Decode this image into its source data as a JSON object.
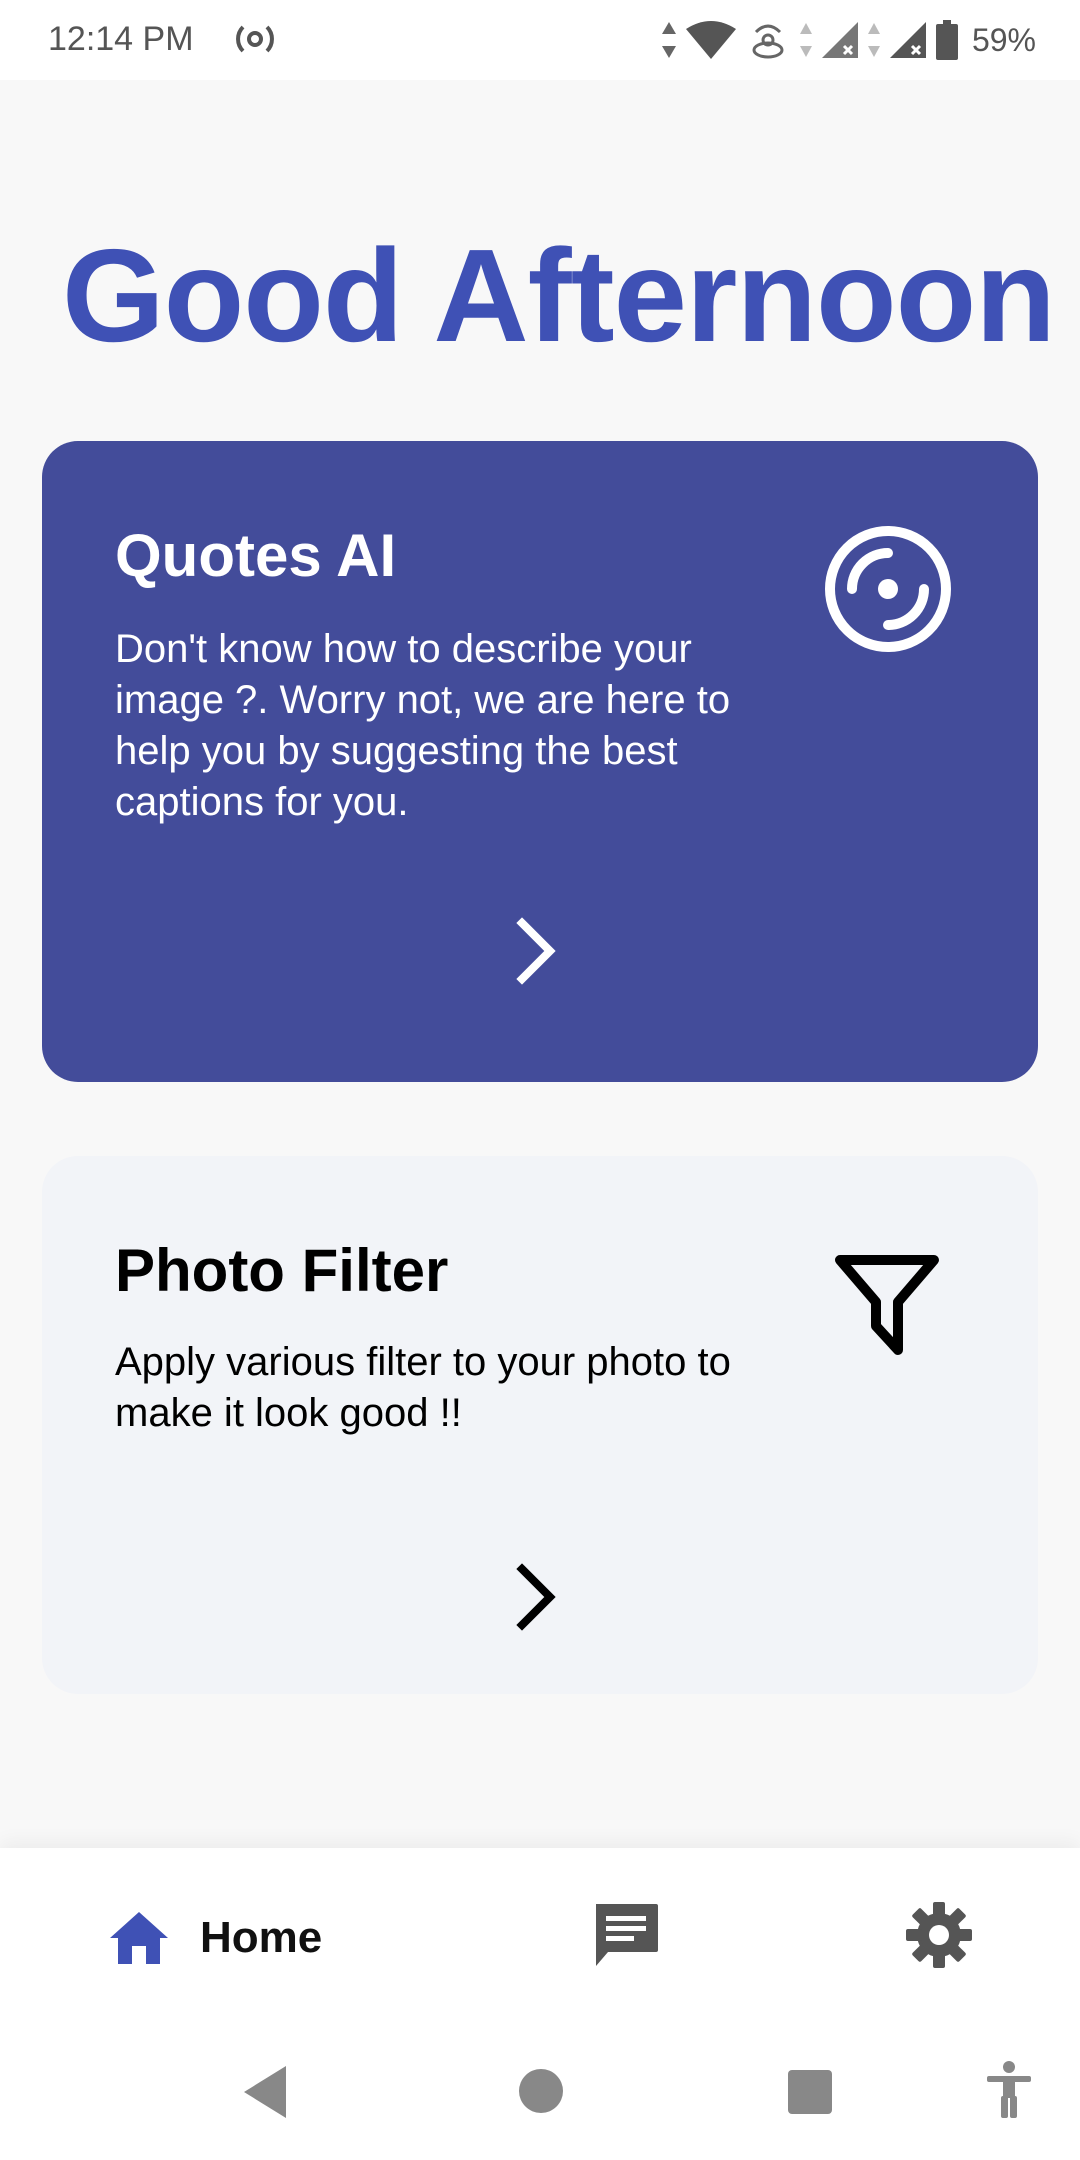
{
  "status_bar": {
    "time": "12:14 PM",
    "battery_percent": "59%",
    "icons": [
      "radio-icon",
      "data-arrows-icon",
      "wifi-icon",
      "hotspot-icon",
      "signal-icon",
      "signal-icon",
      "battery-icon"
    ]
  },
  "greeting": "Good Afternoon",
  "cards": {
    "quotes": {
      "title": "Quotes AI",
      "description": "Don't know how to describe your image ?. Worry not, we are here to help you by suggesting the best captions for you.",
      "icon": "disc-icon",
      "background": "#434c9a"
    },
    "filter": {
      "title": "Photo Filter",
      "description": "Apply various filter to your photo to make it look good !!",
      "icon": "filter-icon",
      "background": "#f2f4f8"
    }
  },
  "bottom_nav": {
    "home_label": "Home",
    "items": [
      "home-icon",
      "chat-icon",
      "gear-icon"
    ],
    "accent": "#3f51b5"
  },
  "system_nav": [
    "back-icon",
    "home-circle-icon",
    "recents-icon",
    "accessibility-icon"
  ]
}
